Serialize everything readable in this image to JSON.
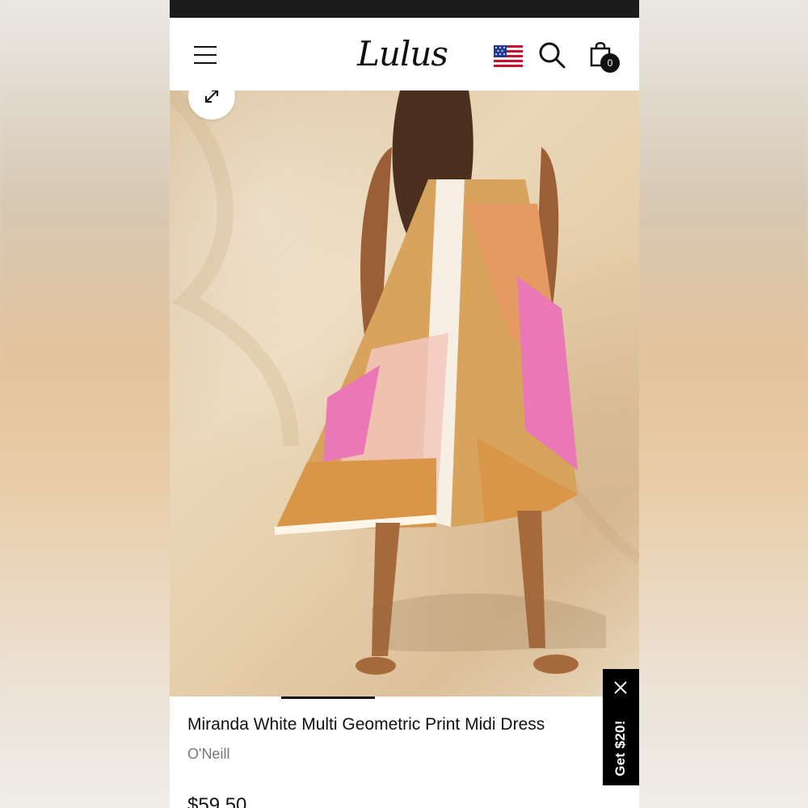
{
  "header": {
    "logo": "Lulus",
    "cart_count": "0",
    "icons": [
      "menu-icon",
      "us-flag-icon",
      "search-icon",
      "shopping-bag-icon"
    ]
  },
  "product": {
    "title": "Miranda White Multi Geometric Print Midi Dress",
    "brand": "O'Neill",
    "price": "$59.50"
  },
  "promo": {
    "label": "Get $20!"
  },
  "colors": {
    "primary": "#111111",
    "secondary_text": "#777777",
    "promo_background": "#000000"
  }
}
